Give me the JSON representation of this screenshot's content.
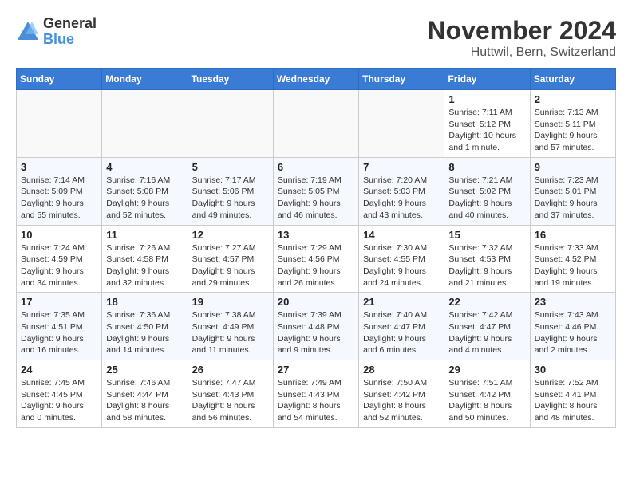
{
  "header": {
    "logo_general": "General",
    "logo_blue": "Blue",
    "month_year": "November 2024",
    "location": "Huttwil, Bern, Switzerland"
  },
  "calendar": {
    "days_of_week": [
      "Sunday",
      "Monday",
      "Tuesday",
      "Wednesday",
      "Thursday",
      "Friday",
      "Saturday"
    ],
    "weeks": [
      [
        {
          "day": "",
          "info": ""
        },
        {
          "day": "",
          "info": ""
        },
        {
          "day": "",
          "info": ""
        },
        {
          "day": "",
          "info": ""
        },
        {
          "day": "",
          "info": ""
        },
        {
          "day": "1",
          "info": "Sunrise: 7:11 AM\nSunset: 5:12 PM\nDaylight: 10 hours and 1 minute."
        },
        {
          "day": "2",
          "info": "Sunrise: 7:13 AM\nSunset: 5:11 PM\nDaylight: 9 hours and 57 minutes."
        }
      ],
      [
        {
          "day": "3",
          "info": "Sunrise: 7:14 AM\nSunset: 5:09 PM\nDaylight: 9 hours and 55 minutes."
        },
        {
          "day": "4",
          "info": "Sunrise: 7:16 AM\nSunset: 5:08 PM\nDaylight: 9 hours and 52 minutes."
        },
        {
          "day": "5",
          "info": "Sunrise: 7:17 AM\nSunset: 5:06 PM\nDaylight: 9 hours and 49 minutes."
        },
        {
          "day": "6",
          "info": "Sunrise: 7:19 AM\nSunset: 5:05 PM\nDaylight: 9 hours and 46 minutes."
        },
        {
          "day": "7",
          "info": "Sunrise: 7:20 AM\nSunset: 5:03 PM\nDaylight: 9 hours and 43 minutes."
        },
        {
          "day": "8",
          "info": "Sunrise: 7:21 AM\nSunset: 5:02 PM\nDaylight: 9 hours and 40 minutes."
        },
        {
          "day": "9",
          "info": "Sunrise: 7:23 AM\nSunset: 5:01 PM\nDaylight: 9 hours and 37 minutes."
        }
      ],
      [
        {
          "day": "10",
          "info": "Sunrise: 7:24 AM\nSunset: 4:59 PM\nDaylight: 9 hours and 34 minutes."
        },
        {
          "day": "11",
          "info": "Sunrise: 7:26 AM\nSunset: 4:58 PM\nDaylight: 9 hours and 32 minutes."
        },
        {
          "day": "12",
          "info": "Sunrise: 7:27 AM\nSunset: 4:57 PM\nDaylight: 9 hours and 29 minutes."
        },
        {
          "day": "13",
          "info": "Sunrise: 7:29 AM\nSunset: 4:56 PM\nDaylight: 9 hours and 26 minutes."
        },
        {
          "day": "14",
          "info": "Sunrise: 7:30 AM\nSunset: 4:55 PM\nDaylight: 9 hours and 24 minutes."
        },
        {
          "day": "15",
          "info": "Sunrise: 7:32 AM\nSunset: 4:53 PM\nDaylight: 9 hours and 21 minutes."
        },
        {
          "day": "16",
          "info": "Sunrise: 7:33 AM\nSunset: 4:52 PM\nDaylight: 9 hours and 19 minutes."
        }
      ],
      [
        {
          "day": "17",
          "info": "Sunrise: 7:35 AM\nSunset: 4:51 PM\nDaylight: 9 hours and 16 minutes."
        },
        {
          "day": "18",
          "info": "Sunrise: 7:36 AM\nSunset: 4:50 PM\nDaylight: 9 hours and 14 minutes."
        },
        {
          "day": "19",
          "info": "Sunrise: 7:38 AM\nSunset: 4:49 PM\nDaylight: 9 hours and 11 minutes."
        },
        {
          "day": "20",
          "info": "Sunrise: 7:39 AM\nSunset: 4:48 PM\nDaylight: 9 hours and 9 minutes."
        },
        {
          "day": "21",
          "info": "Sunrise: 7:40 AM\nSunset: 4:47 PM\nDaylight: 9 hours and 6 minutes."
        },
        {
          "day": "22",
          "info": "Sunrise: 7:42 AM\nSunset: 4:47 PM\nDaylight: 9 hours and 4 minutes."
        },
        {
          "day": "23",
          "info": "Sunrise: 7:43 AM\nSunset: 4:46 PM\nDaylight: 9 hours and 2 minutes."
        }
      ],
      [
        {
          "day": "24",
          "info": "Sunrise: 7:45 AM\nSunset: 4:45 PM\nDaylight: 9 hours and 0 minutes."
        },
        {
          "day": "25",
          "info": "Sunrise: 7:46 AM\nSunset: 4:44 PM\nDaylight: 8 hours and 58 minutes."
        },
        {
          "day": "26",
          "info": "Sunrise: 7:47 AM\nSunset: 4:43 PM\nDaylight: 8 hours and 56 minutes."
        },
        {
          "day": "27",
          "info": "Sunrise: 7:49 AM\nSunset: 4:43 PM\nDaylight: 8 hours and 54 minutes."
        },
        {
          "day": "28",
          "info": "Sunrise: 7:50 AM\nSunset: 4:42 PM\nDaylight: 8 hours and 52 minutes."
        },
        {
          "day": "29",
          "info": "Sunrise: 7:51 AM\nSunset: 4:42 PM\nDaylight: 8 hours and 50 minutes."
        },
        {
          "day": "30",
          "info": "Sunrise: 7:52 AM\nSunset: 4:41 PM\nDaylight: 8 hours and 48 minutes."
        }
      ]
    ]
  }
}
